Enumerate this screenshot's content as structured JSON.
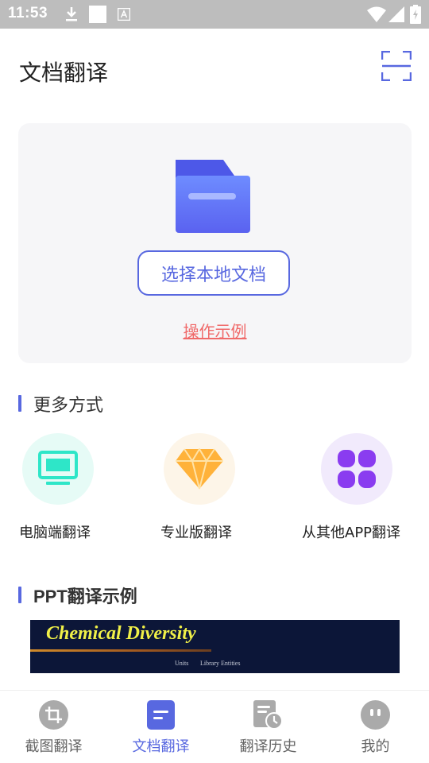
{
  "status_bar": {
    "time": "11:53"
  },
  "header": {
    "title": "文档翻译"
  },
  "upload_card": {
    "select_button": "选择本地文档",
    "example_link": "操作示例"
  },
  "more_methods": {
    "title": "更多方式",
    "items": [
      {
        "label": "电脑端翻译",
        "icon": "monitor-icon",
        "bg_color": "#e6fbf6",
        "icon_color": "#2ee6c8"
      },
      {
        "label": "专业版翻译",
        "icon": "diamond-icon",
        "bg_color": "#fdf5e8",
        "icon_color": "#ffb23a"
      },
      {
        "label": "从其他APP翻译",
        "icon": "clover-icon",
        "bg_color": "#f1eafc",
        "icon_color": "#8a3cf0"
      }
    ]
  },
  "ppt_example": {
    "title": "PPT翻译示例",
    "preview_heading": "Chemical Diversity",
    "preview_sub1": "Units",
    "preview_sub2": "Library Entities"
  },
  "bottom_nav": {
    "items": [
      {
        "label": "截图翻译",
        "icon": "crop-icon",
        "active": false
      },
      {
        "label": "文档翻译",
        "icon": "document-icon",
        "active": true
      },
      {
        "label": "翻译历史",
        "icon": "history-icon",
        "active": false
      },
      {
        "label": "我的",
        "icon": "profile-icon",
        "active": false
      }
    ]
  },
  "colors": {
    "accent": "#5868e0",
    "link": "#f06a6a",
    "inactive_icon": "#aaaaaa"
  }
}
